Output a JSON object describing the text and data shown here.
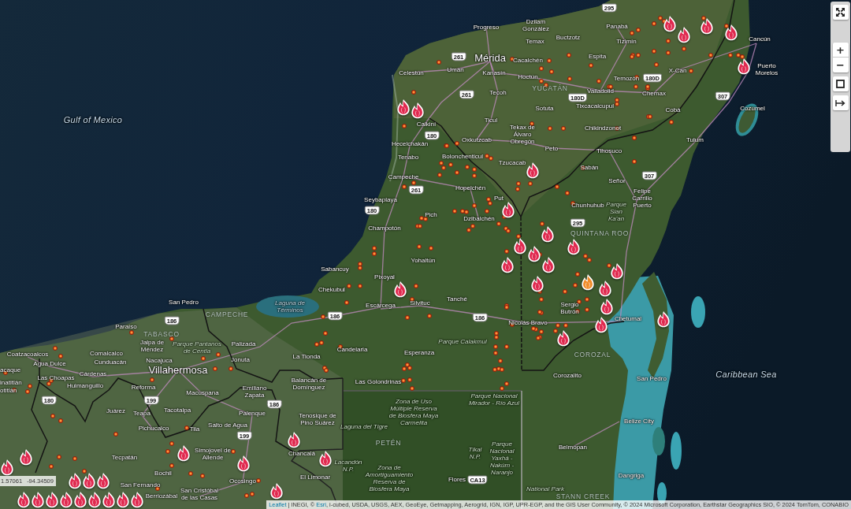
{
  "map": {
    "labels": [
      {
        "text": "295",
        "kind": "shield"
      },
      {
        "text": "Progreso",
        "kind": "city"
      },
      {
        "text": "Dzilam González",
        "kind": "city"
      },
      {
        "text": "Panabá",
        "kind": "city"
      },
      {
        "text": "Temax",
        "kind": "city"
      },
      {
        "text": "Buctzotz",
        "kind": "city"
      },
      {
        "text": "Tizimín",
        "kind": "city"
      },
      {
        "text": "Cancún",
        "kind": "city"
      },
      {
        "text": "261",
        "kind": "shield"
      },
      {
        "text": "Mérida",
        "kind": "major"
      },
      {
        "text": "Cacalchén",
        "kind": "city"
      },
      {
        "text": "Espita",
        "kind": "city"
      },
      {
        "text": "Celestún",
        "kind": "city"
      },
      {
        "text": "Umán",
        "kind": "city"
      },
      {
        "text": "Kanasín",
        "kind": "city"
      },
      {
        "text": "Hoctún",
        "kind": "city"
      },
      {
        "text": "Temozón",
        "kind": "city"
      },
      {
        "text": "180D",
        "kind": "shield"
      },
      {
        "text": "X-Can",
        "kind": "city"
      },
      {
        "text": "Puerto Morelos",
        "kind": "city"
      },
      {
        "text": "261",
        "kind": "shield"
      },
      {
        "text": "Tecoh",
        "kind": "city"
      },
      {
        "text": "YUCATÁN",
        "kind": "state"
      },
      {
        "text": "180D",
        "kind": "shield"
      },
      {
        "text": "Valladolid",
        "kind": "city"
      },
      {
        "text": "Chemax",
        "kind": "city"
      },
      {
        "text": "307",
        "kind": "shield"
      },
      {
        "text": "Sotuta",
        "kind": "city"
      },
      {
        "text": "Tixcacalcupul",
        "kind": "city"
      },
      {
        "text": "Cobá",
        "kind": "city"
      },
      {
        "text": "Cozumel",
        "kind": "city"
      },
      {
        "text": "Gulf of Mexico",
        "kind": "sea"
      },
      {
        "text": "Calkiní",
        "kind": "city"
      },
      {
        "text": "Ticul",
        "kind": "city"
      },
      {
        "text": "180",
        "kind": "shield"
      },
      {
        "text": "Hecelchakán",
        "kind": "city"
      },
      {
        "text": "Oxkutzcab",
        "kind": "city"
      },
      {
        "text": "Tekax de Álvaro Obregón",
        "kind": "city"
      },
      {
        "text": "Chikindzonot",
        "kind": "city"
      },
      {
        "text": "Tulum",
        "kind": "city"
      },
      {
        "text": "Peto",
        "kind": "city"
      },
      {
        "text": "Tihosuco",
        "kind": "city"
      },
      {
        "text": "Tenabo",
        "kind": "city"
      },
      {
        "text": "Bolonchenticul",
        "kind": "city"
      },
      {
        "text": "Tzucacab",
        "kind": "city"
      },
      {
        "text": "Sabán",
        "kind": "city"
      },
      {
        "text": "Campeche",
        "kind": "city"
      },
      {
        "text": "Señor",
        "kind": "city"
      },
      {
        "text": "307",
        "kind": "shield"
      },
      {
        "text": "261",
        "kind": "shield"
      },
      {
        "text": "Hopelchén",
        "kind": "city"
      },
      {
        "text": "Seybaplaya",
        "kind": "city"
      },
      {
        "text": "Put",
        "kind": "city"
      },
      {
        "text": "180",
        "kind": "shield"
      },
      {
        "text": "Chunhuhub",
        "kind": "city"
      },
      {
        "text": "Pich",
        "kind": "city"
      },
      {
        "text": "Dzibalchén",
        "kind": "city"
      },
      {
        "text": "Champotón",
        "kind": "city"
      },
      {
        "text": "295",
        "kind": "shield"
      },
      {
        "text": "Parque Sian Ka'an",
        "kind": "park"
      },
      {
        "text": "Felipe Carrillo Puerto",
        "kind": "city"
      },
      {
        "text": "QUINTANA ROO",
        "kind": "state"
      },
      {
        "text": "Yohaltún",
        "kind": "city"
      },
      {
        "text": "Sabancuy",
        "kind": "city"
      },
      {
        "text": "Pixoyal",
        "kind": "city"
      },
      {
        "text": "Chekubul",
        "kind": "city"
      },
      {
        "text": "San Pedro",
        "kind": "city"
      },
      {
        "text": "Paraíso",
        "kind": "city"
      },
      {
        "text": "186",
        "kind": "shield"
      },
      {
        "text": "CAMPECHE",
        "kind": "state"
      },
      {
        "text": "Laguna de Términos",
        "kind": "water"
      },
      {
        "text": "186",
        "kind": "shield"
      },
      {
        "text": "Escárcega",
        "kind": "city"
      },
      {
        "text": "Silvituc",
        "kind": "city"
      },
      {
        "text": "Tanché",
        "kind": "city"
      },
      {
        "text": "186",
        "kind": "shield"
      },
      {
        "text": "Nicolás Bravo",
        "kind": "city"
      },
      {
        "text": "Sergio Butrón",
        "kind": "city"
      },
      {
        "text": "Chetumal",
        "kind": "city"
      },
      {
        "text": "TABASCO",
        "kind": "state"
      },
      {
        "text": "Coatzacoalcos",
        "kind": "city"
      },
      {
        "text": "Comalcalco",
        "kind": "city"
      },
      {
        "text": "Jalpa de Méndez",
        "kind": "city"
      },
      {
        "text": "Parque Pantanos de Centla",
        "kind": "park"
      },
      {
        "text": "Palizada",
        "kind": "city"
      },
      {
        "text": "Agua Dulce",
        "kind": "city"
      },
      {
        "text": "Cunduacán",
        "kind": "city"
      },
      {
        "text": "Nacajuca",
        "kind": "city"
      },
      {
        "text": "Jonuta",
        "kind": "city"
      },
      {
        "text": "La Tionda",
        "kind": "city"
      },
      {
        "text": "Candelaria",
        "kind": "city"
      },
      {
        "text": "Esperanza",
        "kind": "city"
      },
      {
        "text": "Parque Calakmul",
        "kind": "park"
      },
      {
        "text": "COROZAL",
        "kind": "state"
      },
      {
        "text": "acaque",
        "kind": "city"
      },
      {
        "text": "inatitlán",
        "kind": "city"
      },
      {
        "text": "Las Choapas",
        "kind": "city"
      },
      {
        "text": "Cárdenas",
        "kind": "city"
      },
      {
        "text": "Villahermosa",
        "kind": "major"
      },
      {
        "text": "otitlán",
        "kind": "city"
      },
      {
        "text": "Huimanguillo",
        "kind": "city"
      },
      {
        "text": "Reforma",
        "kind": "city"
      },
      {
        "text": "Macuspana",
        "kind": "city"
      },
      {
        "text": "Emiliano Zapata",
        "kind": "city"
      },
      {
        "text": "Balancán de Domínguez",
        "kind": "city"
      },
      {
        "text": "Las Golondrinas",
        "kind": "city"
      },
      {
        "text": "Corozalito",
        "kind": "city"
      },
      {
        "text": "San Pedro",
        "kind": "city"
      },
      {
        "text": "Caribbean Sea",
        "kind": "sea"
      },
      {
        "text": "180",
        "kind": "shield"
      },
      {
        "text": "199",
        "kind": "shield"
      },
      {
        "text": "Juárez",
        "kind": "city"
      },
      {
        "text": "Teapa",
        "kind": "city"
      },
      {
        "text": "Tacotalpa",
        "kind": "city"
      },
      {
        "text": "186",
        "kind": "shield"
      },
      {
        "text": "Palenque",
        "kind": "city"
      },
      {
        "text": "Pichucalco",
        "kind": "city"
      },
      {
        "text": "Tila",
        "kind": "city"
      },
      {
        "text": "Salto de Agua",
        "kind": "city"
      },
      {
        "text": "Tenosique de Pino Suárez",
        "kind": "city"
      },
      {
        "text": "Laguna del Tigre",
        "kind": "park"
      },
      {
        "text": "Zona de Uso Múltiple Reserva de Biosfera Maya Carmelita",
        "kind": "park"
      },
      {
        "text": "Parque Nacional Mirador - Río Azul",
        "kind": "park"
      },
      {
        "text": "Belize City",
        "kind": "city"
      },
      {
        "text": "199",
        "kind": "shield"
      },
      {
        "text": "PETÉN",
        "kind": "state"
      },
      {
        "text": "Tecpatán",
        "kind": "city"
      },
      {
        "text": "Simojovel de Allende",
        "kind": "city"
      },
      {
        "text": "Chancalá",
        "kind": "city"
      },
      {
        "text": "Tikal N.P.",
        "kind": "park"
      },
      {
        "text": "Bochil",
        "kind": "city"
      },
      {
        "text": "Lacandón N.P.",
        "kind": "park"
      },
      {
        "text": "San Fernando",
        "kind": "city"
      },
      {
        "text": "Ocosingo",
        "kind": "city"
      },
      {
        "text": "El Limonar",
        "kind": "city"
      },
      {
        "text": "Berriozábal",
        "kind": "city"
      },
      {
        "text": "San Cristóbal de las Casas",
        "kind": "city"
      },
      {
        "text": "Zona de Amortiguamiento Reserva de Biosfera Maya",
        "kind": "park"
      },
      {
        "text": "Flores",
        "kind": "city"
      },
      {
        "text": "CA13",
        "kind": "shield"
      },
      {
        "text": "Parque Nacional Yaxhá - Nakúm - Naranjo",
        "kind": "park"
      },
      {
        "text": "Belmopan",
        "kind": "city"
      },
      {
        "text": "Dangriga",
        "kind": "city"
      },
      {
        "text": "National Park",
        "kind": "park"
      },
      {
        "text": "STANN CREEK",
        "kind": "state"
      }
    ],
    "markers": [
      {
        "color": "#e0294f"
      },
      {
        "color": "#e0294f"
      },
      {
        "color": "#e0294f"
      },
      {
        "color": "#e0294f"
      },
      {
        "color": "#e0294f"
      },
      {
        "color": "#e0294f"
      },
      {
        "color": "#e0294f"
      },
      {
        "color": "#e0294f"
      },
      {
        "color": "#e0294f"
      },
      {
        "color": "#e0294f"
      },
      {
        "color": "#e0294f"
      },
      {
        "color": "#e0294f"
      },
      {
        "color": "#e0294f"
      },
      {
        "color": "#e0294f"
      },
      {
        "color": "#e0294f"
      },
      {
        "color": "#e0294f"
      },
      {
        "color": "#e0294f"
      },
      {
        "color": "#f08c2a"
      },
      {
        "color": "#e0294f"
      },
      {
        "color": "#e0294f"
      },
      {
        "color": "#e0294f"
      },
      {
        "color": "#e0294f"
      },
      {
        "color": "#e0294f"
      },
      {
        "color": "#e0294f"
      },
      {
        "color": "#e0294f"
      },
      {
        "color": "#e0294f"
      },
      {
        "color": "#e0294f"
      },
      {
        "color": "#e0294f"
      },
      {
        "color": "#e0294f"
      },
      {
        "color": "#e0294f"
      },
      {
        "color": "#e0294f"
      },
      {
        "color": "#e0294f"
      },
      {
        "color": "#e0294f"
      },
      {
        "color": "#e0294f"
      },
      {
        "color": "#e0294f"
      },
      {
        "color": "#e0294f"
      },
      {
        "color": "#e0294f"
      },
      {
        "color": "#e0294f"
      },
      {
        "color": "#e0294f"
      },
      {
        "color": "#e0294f"
      },
      {
        "color": "#e0294f"
      },
      {
        "color": "#e0294f"
      },
      {
        "color": "#e0294f"
      }
    ]
  },
  "controls": {
    "zoom_in": "+",
    "zoom_out": "−"
  },
  "coordinates": {
    "latitude": "1.57061",
    "longitude": "-94.34509"
  },
  "attribution": [
    {
      "text": "Leaflet",
      "kind": "link"
    },
    {
      "text": " | INEGI, © ",
      "kind": "text"
    },
    {
      "text": "Esri",
      "kind": "link"
    },
    {
      "text": ", i-cubed, USDA, USGS, AEX, GeoEye, Getmapping, Aerogrid, IGN, IGP, UPR-EGP, and the GIS User Community, © 2024 Microsoft Corporation, Earthstar Geographics SIO, © 2024 TomTom, CONABIO",
      "kind": "text"
    }
  ]
}
